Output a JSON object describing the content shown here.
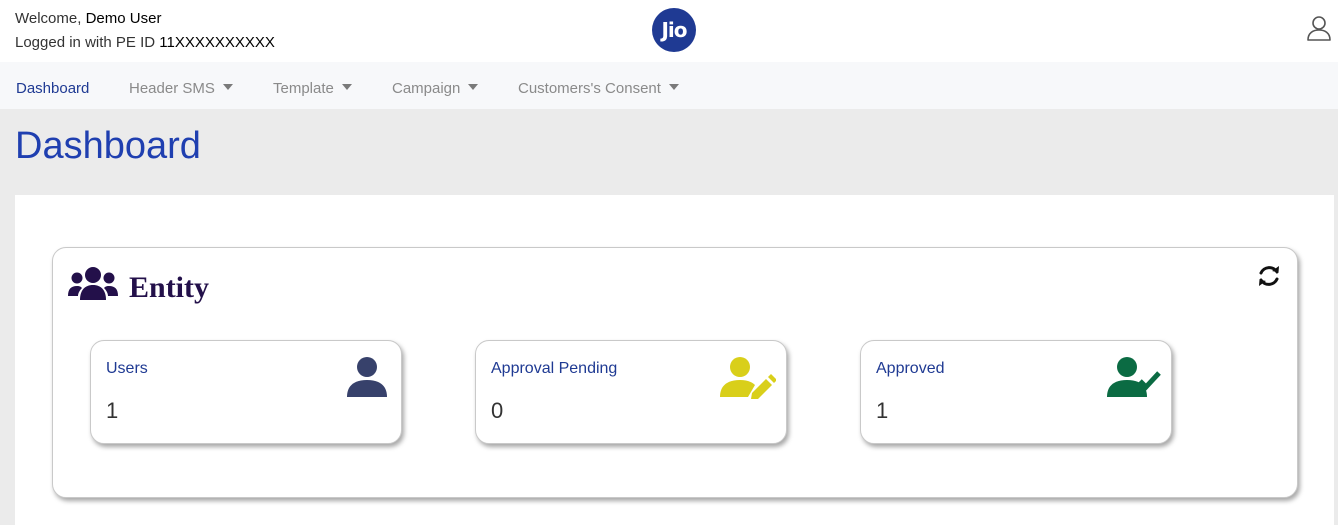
{
  "header": {
    "welcome_prefix": "Welcome,",
    "user_name": "Demo User",
    "login_prefix": "Logged in with PE ID",
    "pe_id": "11XXXXXXXXXX",
    "logo_text": "Jio"
  },
  "nav": {
    "items": [
      {
        "label": "Dashboard",
        "active": true
      },
      {
        "label": "Header SMS"
      },
      {
        "label": "Template"
      },
      {
        "label": "Campaign"
      },
      {
        "label": "Customers's Consent"
      }
    ]
  },
  "page": {
    "title": "Dashboard"
  },
  "entity": {
    "title": "Entity",
    "icon": "users-group-icon",
    "refresh_icon": "refresh-icon",
    "stats": [
      {
        "label": "Users",
        "value": "1",
        "icon": "user-icon",
        "color": "#37416b"
      },
      {
        "label": "Approval Pending",
        "value": "0",
        "icon": "user-edit-icon",
        "color": "#d9cf1a"
      },
      {
        "label": "Approved",
        "value": "1",
        "icon": "user-check-icon",
        "color": "#0b6b43"
      }
    ]
  },
  "colors": {
    "brand": "#1f3a93",
    "title": "#1f3fb0",
    "entity_title": "#23104a"
  }
}
